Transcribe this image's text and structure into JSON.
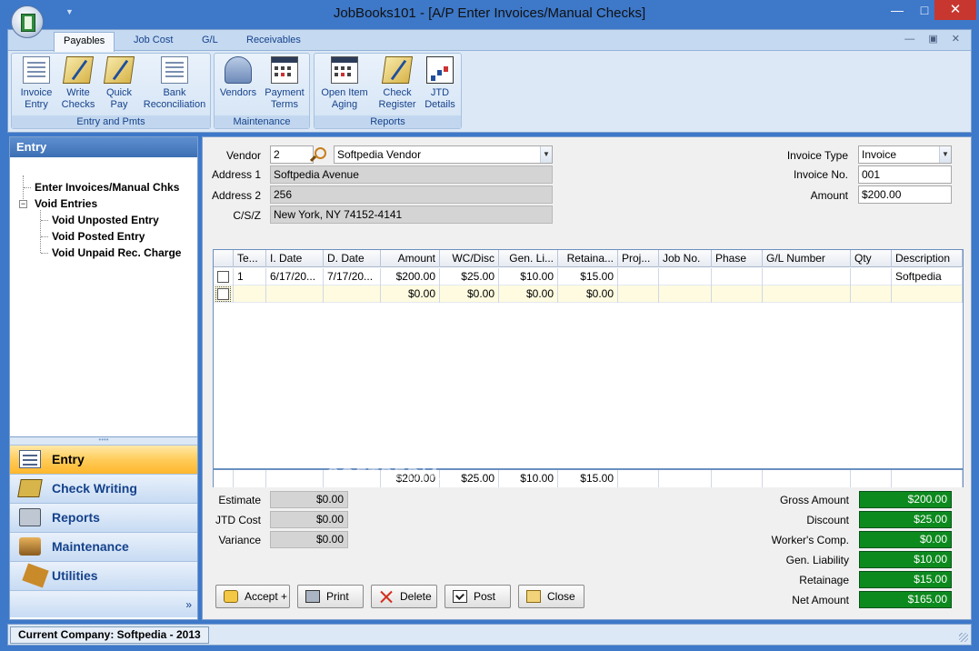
{
  "window": {
    "title": "JobBooks101 - [A/P Enter Invoices/Manual Checks]"
  },
  "ribbon": {
    "tabs": [
      "Payables",
      "Job Cost",
      "G/L",
      "Receivables"
    ],
    "groups": {
      "entry": {
        "label": "Entry and Pmts",
        "buttons": [
          "Invoice\nEntry",
          "Write\nChecks",
          "Quick\nPay",
          "Bank\nReconciliation"
        ]
      },
      "maintenance": {
        "label": "Maintenance",
        "buttons": [
          "Vendors",
          "Payment\nTerms"
        ]
      },
      "reports": {
        "label": "Reports",
        "buttons": [
          "Open Item\nAging",
          "Check\nRegister",
          "JTD\nDetails"
        ]
      }
    }
  },
  "nav": {
    "header": "Entry",
    "tree": [
      "Enter Invoices/Manual Chks",
      "Void Entries",
      "Void Unposted Entry",
      "Void Posted Entry",
      "Void Unpaid Rec. Charge"
    ],
    "buttons": [
      "Entry",
      "Check Writing",
      "Reports",
      "Maintenance",
      "Utilities"
    ],
    "footer_icon": "»"
  },
  "form": {
    "vendor_label": "Vendor",
    "vendor_id": "2",
    "vendor_name": "Softpedia Vendor",
    "address1_label": "Address 1",
    "address1": "Softpedia Avenue",
    "address2_label": "Address 2",
    "address2": "256",
    "csz_label": "C/S/Z",
    "csz": "New York, NY 74152-4141",
    "invoice_type_label": "Invoice Type",
    "invoice_type": "Invoice",
    "invoice_no_label": "Invoice No.",
    "invoice_no": "001",
    "amount_label": "Amount",
    "amount": "$200.00"
  },
  "grid": {
    "columns": [
      "Te...",
      "I. Date",
      "D. Date",
      "Amount",
      "WC/Disc",
      "Gen. Li...",
      "Retaina...",
      "Proj...",
      "Job No.",
      "Phase",
      "G/L Number",
      "Qty",
      "Description"
    ],
    "rows": [
      [
        "1",
        "6/17/20...",
        "7/17/20...",
        "$200.00",
        "$25.00",
        "$10.00",
        "$15.00",
        "",
        "",
        "",
        "",
        "",
        "Softpedia"
      ],
      [
        "",
        "",
        "",
        "$0.00",
        "$0.00",
        "$0.00",
        "$0.00",
        "",
        "",
        "",
        "",
        "",
        ""
      ]
    ],
    "totals": [
      "",
      "",
      "",
      "$200.00",
      "$25.00",
      "$10.00",
      "$15.00",
      "",
      "",
      "",
      "",
      "",
      ""
    ]
  },
  "estimates": {
    "estimate_label": "Estimate",
    "estimate": "$0.00",
    "jtd_label": "JTD Cost",
    "jtd": "$0.00",
    "variance_label": "Variance",
    "variance": "$0.00"
  },
  "totals": {
    "gross_label": "Gross Amount",
    "gross": "$200.00",
    "discount_label": "Discount",
    "discount": "$25.00",
    "workers_label": "Worker's Comp.",
    "workers": "$0.00",
    "genliab_label": "Gen. Liability",
    "genliab": "$10.00",
    "retainage_label": "Retainage",
    "retainage": "$15.00",
    "net_label": "Net Amount",
    "net": "$165.00"
  },
  "buttons": {
    "accept": "Accept +",
    "print": "Print",
    "delete": "Delete",
    "post": "Post",
    "close": "Close"
  },
  "status": {
    "company": "Current Company:  Softpedia - 2013"
  },
  "watermark": "SOFTPEDIA",
  "colors": {
    "total_green": "#0d8a1e",
    "title_blue": "#3d78c9",
    "active_nav": "#ffcc5a"
  }
}
